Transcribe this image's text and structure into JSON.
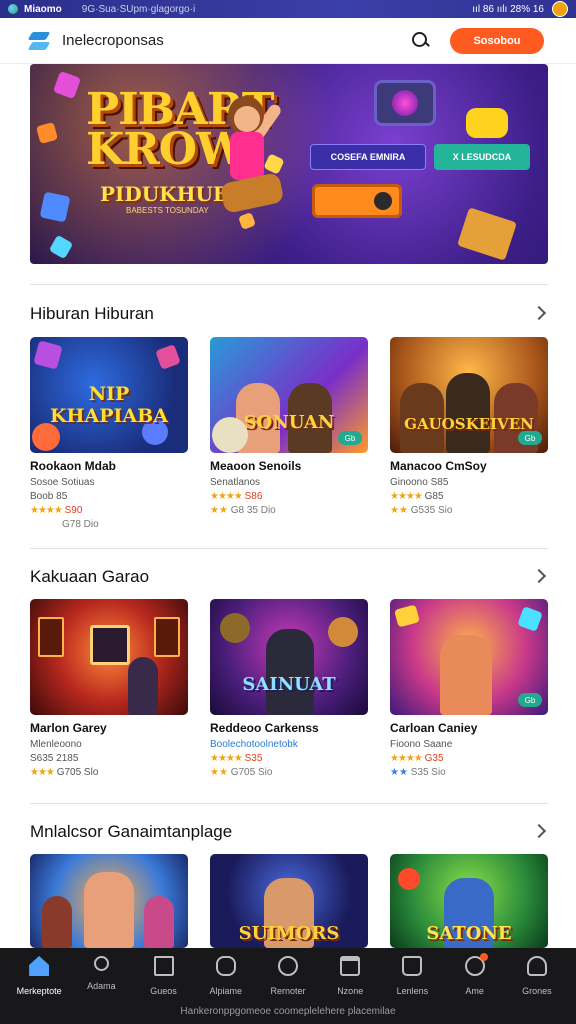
{
  "status_bar": {
    "carrier": "Miaomo",
    "notification": "9G·Sua·SUpm·glagorgo·i",
    "indicators": "ııl 86 ıılı 28% 16"
  },
  "header": {
    "title": "Inelecroponsas",
    "cta_label": "Sosobou"
  },
  "banner": {
    "title_line1": "PIBART",
    "title_line2": "KROW",
    "subtitle": "PIDUKHUBIAH",
    "tagline": "BABESTS TOSUNDAY",
    "pill_a": "COSEFA EMNIRA",
    "pill_b": "X LESUDCDA"
  },
  "sections": [
    {
      "title": "Hiburan Hiburan",
      "cards": [
        {
          "art": "NIP KHAPIABA",
          "name": "Rookaon Mdab",
          "sub": "Sosoe Sotiuas",
          "meta1": "Boob 85",
          "stars": "★★★★",
          "meta2": "S90",
          "extra": "G78 Dio"
        },
        {
          "art": "SONUAN",
          "name": "Meaoon Senoils",
          "sub": "Senatlanos",
          "meta1": "",
          "stars": "★★★★",
          "meta2": "S86",
          "extra": "G8 35 Dio",
          "badge": "Gb"
        },
        {
          "art": "GAUOSKEIVEN",
          "name": "Manacoo CmSoy",
          "sub": "Ginoono S85",
          "meta1": "",
          "stars": "★★★★",
          "meta2": "G85",
          "extra": "G535 Sio",
          "badge": "Gb"
        }
      ]
    },
    {
      "title": "Kakuaan Garao",
      "cards": [
        {
          "art": "",
          "name": "Marlon Garey",
          "sub": "Mlenleoono",
          "meta1": "S635 2185",
          "stars": "★★★",
          "meta2": "G705 Slo",
          "extra": ""
        },
        {
          "art": "SAINUAT",
          "name": "Reddeoo Carkenss",
          "sub": "Boolechotoolnetobk",
          "subLink": true,
          "meta1": "",
          "stars": "★★★★",
          "meta2": "S35",
          "extra": "G705 Sio"
        },
        {
          "art": "",
          "name": "Carloan Caniey",
          "sub": "Fioono Saane",
          "meta1": "",
          "stars": "★★★★",
          "meta2": "G35",
          "extra": "S35 Sio",
          "blue": true,
          "badge": "Gb"
        }
      ]
    },
    {
      "title": "Mnlalcsor Ganaimtanplage",
      "cards": [
        {
          "art": "",
          "name": "",
          "sub": "",
          "meta1": "",
          "stars": "",
          "meta2": "",
          "extra": ""
        },
        {
          "art": "SUIMORS",
          "name": "",
          "sub": "",
          "meta1": "",
          "stars": "",
          "meta2": "",
          "extra": ""
        },
        {
          "art": "SATONE",
          "name": "",
          "sub": "",
          "meta1": "",
          "stars": "",
          "meta2": "",
          "extra": ""
        }
      ]
    }
  ],
  "bottom_nav": {
    "items": [
      {
        "label": "Merkeptote",
        "icon": "home-icon"
      },
      {
        "label": "Adama",
        "icon": "search-icon"
      },
      {
        "label": "Gueos",
        "icon": "list-icon"
      },
      {
        "label": "Alpiame",
        "icon": "ring-icon"
      },
      {
        "label": "Rernoter",
        "icon": "clock-icon"
      },
      {
        "label": "Nzone",
        "icon": "box-icon"
      },
      {
        "label": "Lenlens",
        "icon": "bag-icon"
      },
      {
        "label": "Ame",
        "icon": "bell-icon"
      },
      {
        "label": "Grones",
        "icon": "user-icon"
      }
    ],
    "footer": "Hankeronppgomeoe coomeplelehere placemilae"
  }
}
